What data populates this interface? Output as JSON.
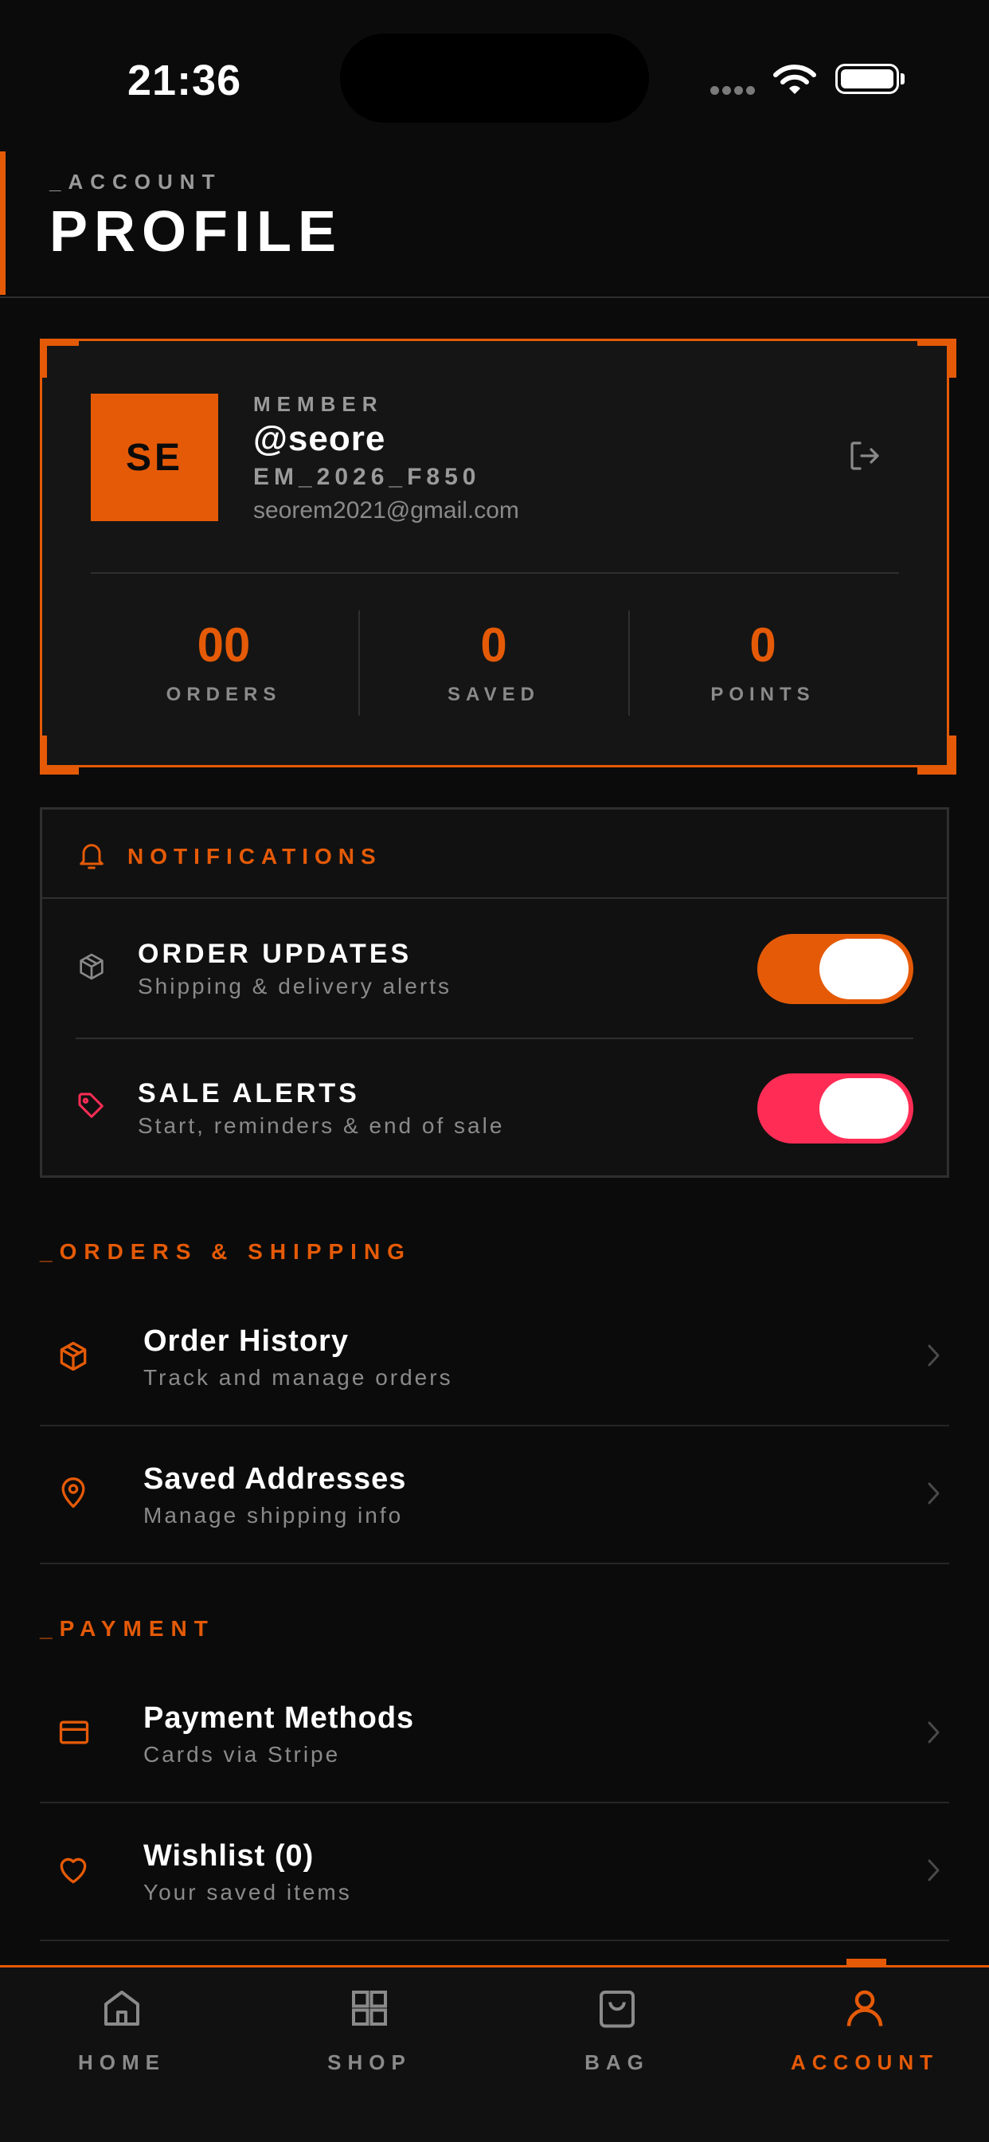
{
  "status_bar": {
    "time": "21:36"
  },
  "header": {
    "kicker": "_ACCOUNT",
    "title": "PROFILE"
  },
  "profile": {
    "initials": "SE",
    "member_label": "MEMBER",
    "handle": "@seore",
    "member_id": "EM_2026_F850",
    "email": "seorem2021@gmail.com",
    "stats": [
      {
        "value": "00",
        "label": "ORDERS"
      },
      {
        "value": "0",
        "label": "SAVED"
      },
      {
        "value": "0",
        "label": "POINTS"
      }
    ]
  },
  "notifications": {
    "title": "NOTIFICATIONS",
    "items": [
      {
        "title": "ORDER UPDATES",
        "subtitle": "Shipping & delivery alerts",
        "enabled": true,
        "color": "#e55a07",
        "icon": "package-icon"
      },
      {
        "title": "SALE ALERTS",
        "subtitle": "Start, reminders & end of sale",
        "enabled": true,
        "color": "#ff2d55",
        "icon": "tag-icon"
      }
    ]
  },
  "orders_shipping": {
    "heading": "_ORDERS & SHIPPING",
    "items": [
      {
        "title": "Order History",
        "subtitle": "Track and manage orders",
        "icon": "package-icon"
      },
      {
        "title": "Saved Addresses",
        "subtitle": "Manage shipping info",
        "icon": "map-pin-icon"
      }
    ]
  },
  "payment": {
    "heading": "_PAYMENT",
    "items": [
      {
        "title": "Payment Methods",
        "subtitle": "Cards via Stripe",
        "icon": "credit-card-icon"
      },
      {
        "title": "Wishlist (0)",
        "subtitle": "Your saved items",
        "icon": "heart-icon"
      }
    ]
  },
  "tabbar": {
    "items": [
      {
        "label": "HOME",
        "icon": "home-icon",
        "active": false
      },
      {
        "label": "SHOP",
        "icon": "grid-icon",
        "active": false
      },
      {
        "label": "BAG",
        "icon": "bag-icon",
        "active": false
      },
      {
        "label": "ACCOUNT",
        "icon": "user-icon",
        "active": true
      }
    ]
  },
  "colors": {
    "accent": "#e55a07",
    "sale": "#ff2d55",
    "background": "#0b0b0b",
    "muted": "#8a8a8a"
  }
}
